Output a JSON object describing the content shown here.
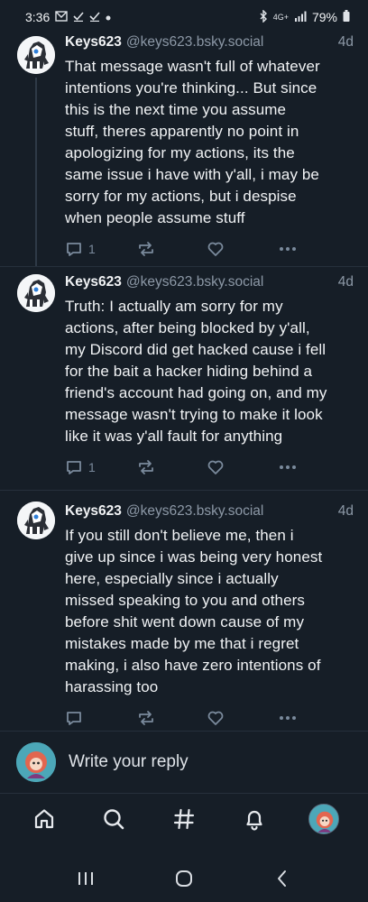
{
  "status_bar": {
    "time": "3:36",
    "left_icons": [
      "mail-icon",
      "check-icon",
      "check-icon",
      "dot-icon"
    ],
    "right_icons": [
      "bluetooth-icon",
      "lte-icon",
      "signal-icon"
    ],
    "network": "4G+",
    "battery": "79%"
  },
  "posts": [
    {
      "author_name": "Keys623",
      "author_handle": "@keys623.bsky.social",
      "time": "4d",
      "text": "That message wasn't full of whatever\nintentions you're thinking... But since\nthis is the next time you assume\nstuff, theres apparently no point in\napologizing for my actions, its the\nsame issue i have with y'all, i may be\nsorry for my actions, but i despise\nwhen people assume stuff",
      "reply_count": "1",
      "repost_count": "",
      "like_count": ""
    },
    {
      "author_name": "Keys623",
      "author_handle": "@keys623.bsky.social",
      "time": "4d",
      "text": "Truth: I actually am sorry for my\nactions, after being blocked by y'all,\nmy Discord did get hacked cause i fell\nfor the bait a hacker hiding behind a\nfriend's account had going on, and my\nmessage wasn't trying to make it look\nlike it was y'all fault for anything",
      "reply_count": "1",
      "repost_count": "",
      "like_count": ""
    },
    {
      "author_name": "Keys623",
      "author_handle": "@keys623.bsky.social",
      "time": "4d",
      "text": "If you still don't believe me, then i\ngive up since i was being very honest\nhere, especially since i actually\nmissed speaking to you and others\nbefore shit went down cause of my\nmistakes made by me that i regret\nmaking, i also have zero intentions of\nharassing too",
      "reply_count": "",
      "repost_count": "",
      "like_count": ""
    }
  ],
  "reply_bar": {
    "placeholder": "Write your reply"
  },
  "tab_bar": {
    "items": [
      "home-icon",
      "search-icon",
      "feeds-hash-icon",
      "notifications-bell-icon",
      "profile-avatar"
    ]
  },
  "nav_bar": {
    "items": [
      "recents-icon",
      "home-circle-icon",
      "back-chevron-icon"
    ]
  },
  "colors": {
    "background": "#161e27",
    "text": "#f1f3f5",
    "muted": "#8c98a6",
    "action_icon": "#7a8a9c",
    "divider": "#26303c"
  }
}
